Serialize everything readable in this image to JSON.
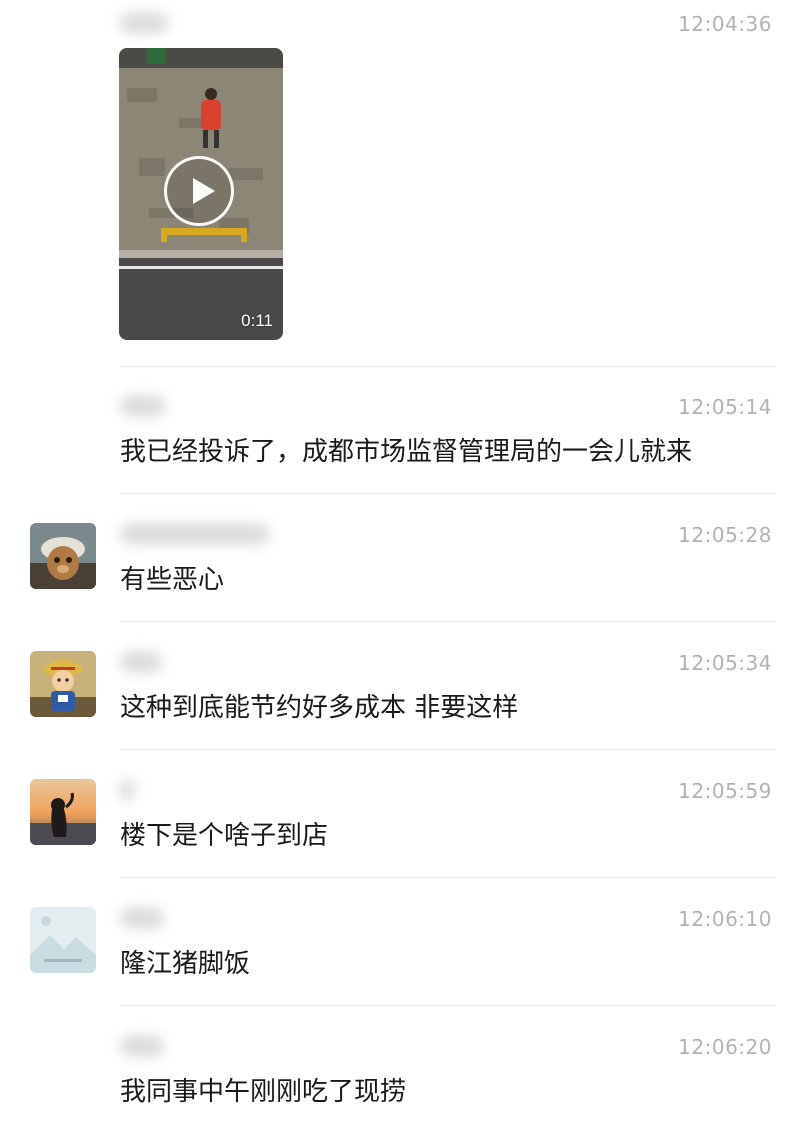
{
  "messages": [
    {
      "time": "12:04:36",
      "video_duration": "0:11"
    },
    {
      "time": "12:05:14",
      "text": "我已经投诉了，成都市场监督管理局的一会儿就来"
    },
    {
      "time": "12:05:28",
      "text": "有些恶心"
    },
    {
      "time": "12:05:34",
      "text": "这种到底能节约好多成本 非要这样"
    },
    {
      "time": "12:05:59",
      "text": "楼下是个啥子到店"
    },
    {
      "time": "12:06:10",
      "text": "隆江猪脚饭"
    },
    {
      "time": "12:06:20",
      "text": "我同事中午刚刚吃了现捞"
    }
  ]
}
